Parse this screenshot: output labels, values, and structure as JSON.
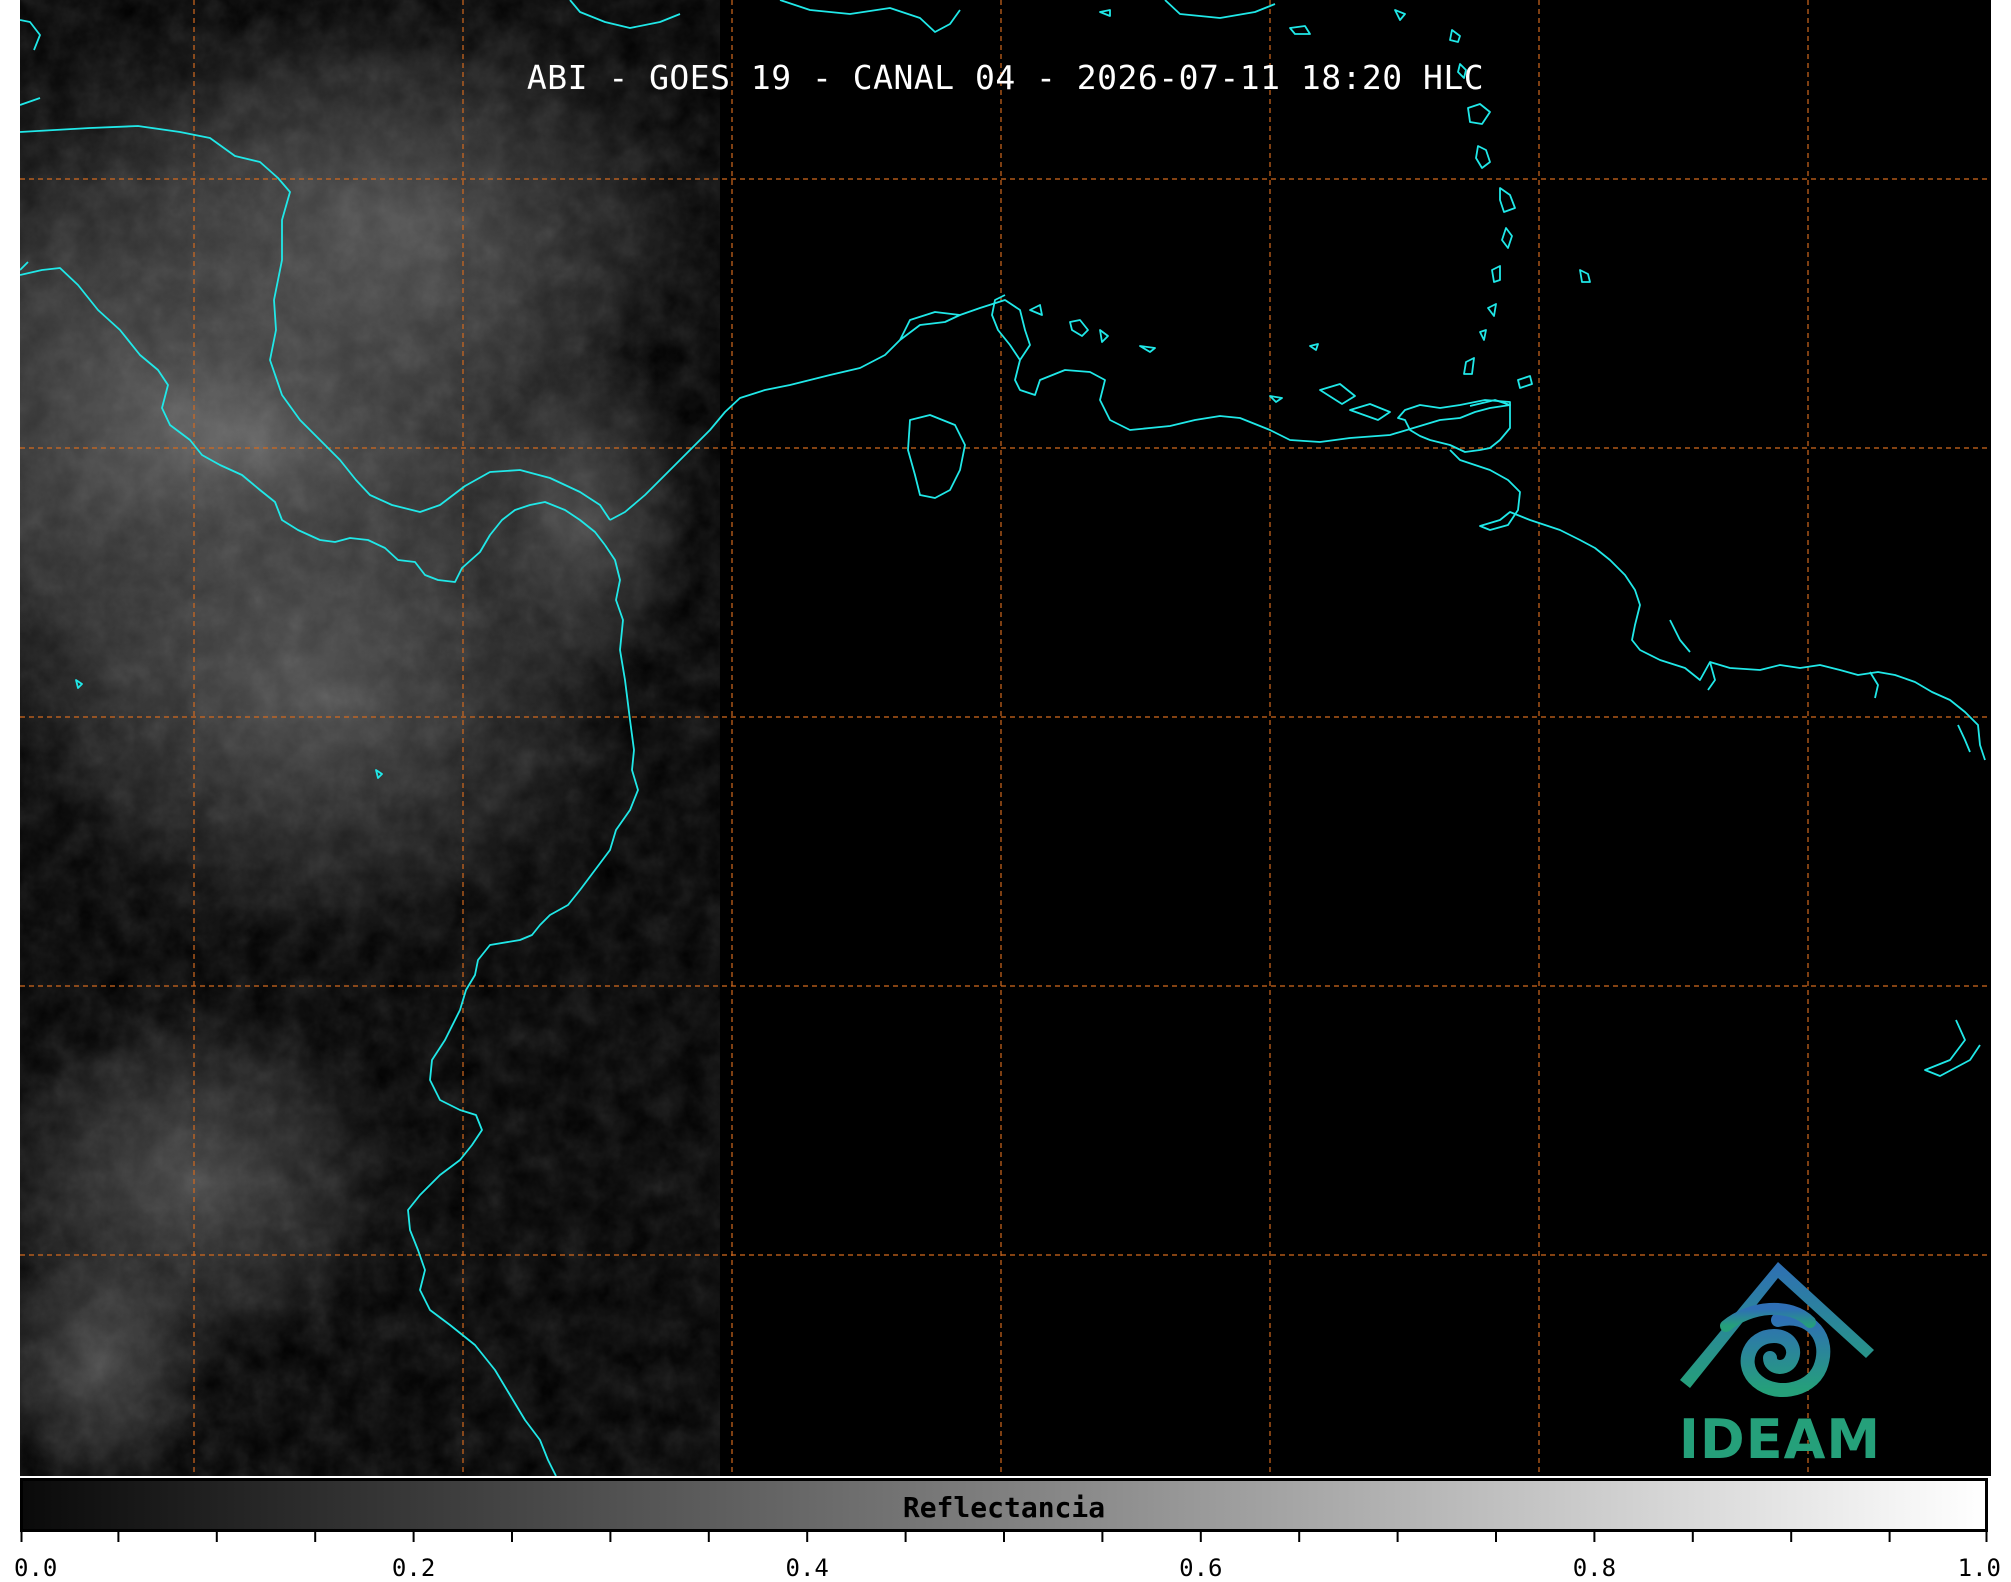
{
  "map": {
    "title": "ABI - GOES 19 - CANAL 04 - 2026-07-11 18:20 HLC",
    "coastline_color": "#20e8e8",
    "graticule_color": "#d2691e",
    "background_color": "#000000"
  },
  "logo": {
    "text": "IDEAM",
    "icon": "ideam-logo-icon",
    "color_top": "#2f6fb5",
    "color_bottom": "#25a07a"
  },
  "colorbar": {
    "label": "Reflectancia",
    "min": 0.0,
    "max": 1.0,
    "tick_labels": [
      "0.0",
      "0.2",
      "0.4",
      "0.6",
      "0.8",
      "1.0"
    ],
    "tick_values": [
      0.0,
      0.2,
      0.4,
      0.6,
      0.8,
      1.0
    ],
    "minor_tick_step": 0.05
  }
}
